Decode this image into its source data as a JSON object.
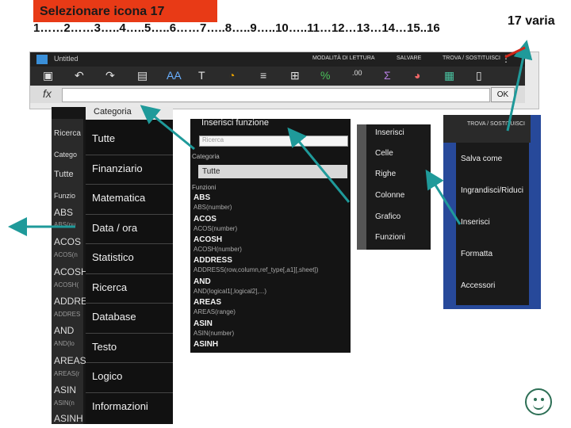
{
  "slide": {
    "title": "Selezionare icona 17",
    "numbers": "1……2……3…..4…..5…..6……7…..8…..9…..10…..11…12…13…14…15..16",
    "varia": "17 varia"
  },
  "app": {
    "title": "Untitled",
    "toolbar_labels": [
      "MODALITÀ DI LETTURA",
      "SALVARE",
      "TROVA / SOSTITUISCI"
    ],
    "fx": "fx",
    "ok": "OK"
  },
  "panel_category": {
    "header": "Categoria",
    "items": [
      "Tutte",
      "Finanziario",
      "Matematica",
      "Data / ora",
      "Statistico",
      "Ricerca",
      "Database",
      "Testo",
      "Logico",
      "Informazioni"
    ],
    "left_items": [
      "Ricerca",
      "Catego",
      "Tutte",
      "Funzio",
      "ABS",
      "ABS(nu",
      "ACOS",
      "ACOS(n",
      "ACOSH",
      "ACOSH(",
      "ADDRE",
      "ADDRES",
      "AND",
      "AND(lo",
      "AREAS",
      "AREAS(r",
      "ASIN",
      "ASIN(n",
      "ASINH"
    ]
  },
  "panel_functions": {
    "title": "Inserisci funzione",
    "search_placeholder": "Ricerca",
    "category_label": "Categoria",
    "category_value": "Tutte",
    "functions_label": "Funzioni",
    "functions": [
      {
        "name": "ABS",
        "sig": "ABS(number)"
      },
      {
        "name": "ACOS",
        "sig": "ACOS(number)"
      },
      {
        "name": "ACOSH",
        "sig": "ACOSH(number)"
      },
      {
        "name": "ADDRESS",
        "sig": "ADDRESS(row,column,ref_type[,a1][,sheet])"
      },
      {
        "name": "AND",
        "sig": "AND(logical1[,logical2],...)"
      },
      {
        "name": "AREAS",
        "sig": "AREAS(range)"
      },
      {
        "name": "ASIN",
        "sig": "ASIN(number)"
      },
      {
        "name": "ASINH",
        "sig": ""
      }
    ]
  },
  "panel_insert": {
    "title": "Inserisci",
    "items": [
      "Celle",
      "Righe",
      "Colonne",
      "Grafico",
      "Funzioni"
    ]
  },
  "panel_menu": {
    "top": "TROVA / SOSTITUISCI",
    "items": [
      "Salva come",
      "Ingrandisci/Riduci",
      "Inserisci",
      "Formatta",
      "Accessori"
    ]
  },
  "colors": {
    "title_bg": "#e83a16",
    "arrow": "#1f9a9a",
    "panel_blue": "#27499a"
  }
}
